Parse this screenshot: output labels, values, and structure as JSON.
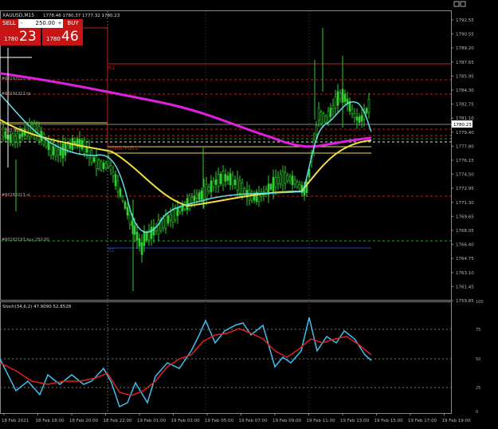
{
  "window": {
    "symbol_title": "XAUUSD,M15",
    "ohlc_text": "1778.46 1780.37 1777.32 1780.23"
  },
  "trade_panel": {
    "sell_label": "SELL",
    "buy_label": "BUY",
    "lot_value": "250.00",
    "minus_label": "-",
    "plus_label": "+",
    "sell_price_small": "1780",
    "sell_price_big": "23",
    "buy_price_small": "1780",
    "buy_price_big": "46"
  },
  "price_axis": {
    "labels": [
      "1792.55",
      "1790.55",
      "1789.20",
      "1787.65",
      "1785.95",
      "1784.30",
      "1782.75",
      "1781.10",
      "1779.40",
      "1777.80",
      "1776.15",
      "1774.50",
      "1772.95",
      "1771.30",
      "1769.65",
      "1768.05",
      "1766.40",
      "1764.75",
      "1763.10",
      "1761.45",
      "1759.85"
    ],
    "current_price": "1780.23"
  },
  "level_labels": {
    "r1": "R1",
    "pivot": "Pivot Point",
    "s1": "S1",
    "order_1": "#60193120 tp",
    "order_2": "#60191222 tp",
    "order_3": "#60176133 sl",
    "order_4": "#60183213 sl",
    "order_5": "#60183193 buy 250.00"
  },
  "stoch": {
    "title": "Stoch(34,6,2) 47.9090 52.8528",
    "levels": [
      "75",
      "50",
      "25"
    ],
    "axis_labels": [
      "100",
      "75",
      "50",
      "25",
      "0"
    ]
  },
  "time_axis": {
    "labels": [
      "18 Feb 2021",
      "18 Feb 18:00",
      "18 Feb 20:00",
      "18 Feb 22:00",
      "19 Feb 01:00",
      "19 Feb 03:00",
      "19 Feb 05:00",
      "19 Feb 07:00",
      "19 Feb 09:00",
      "19 Feb 11:00",
      "19 Feb 13:00",
      "19 Feb 15:00",
      "19 Feb 17:00",
      "19 Feb 19:00"
    ]
  },
  "colors": {
    "background": "#000000",
    "candle": "#32cd32",
    "ma_magenta": "#e020e0",
    "ma_yellow": "#f0e040",
    "ma_cyan": "#60e0e0",
    "stoch_main": "#40c0f0",
    "stoch_signal": "#e02020",
    "resistance": "#c02020",
    "support_green": "#20a020",
    "support_blue": "#2040c0",
    "sell_button": "#c81414"
  }
}
